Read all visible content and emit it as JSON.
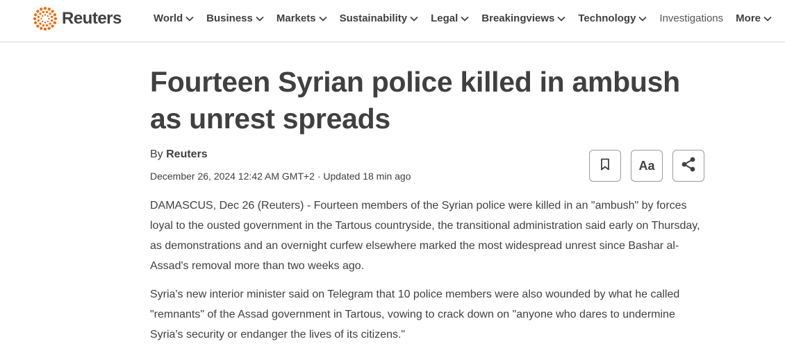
{
  "brand": {
    "name": "Reuters",
    "accent": "#fa6400"
  },
  "nav": {
    "items": [
      {
        "label": "World",
        "dropdown": true
      },
      {
        "label": "Business",
        "dropdown": true
      },
      {
        "label": "Markets",
        "dropdown": true
      },
      {
        "label": "Sustainability",
        "dropdown": true
      },
      {
        "label": "Legal",
        "dropdown": true
      },
      {
        "label": "Breakingviews",
        "dropdown": true
      },
      {
        "label": "Technology",
        "dropdown": true
      },
      {
        "label": "Investigations",
        "dropdown": false
      },
      {
        "label": "More",
        "dropdown": true
      }
    ]
  },
  "article": {
    "headline": "Fourteen Syrian police killed in ambush as unrest spreads",
    "byline_prefix": "By ",
    "byline_author": "Reuters",
    "dateline": "December 26, 2024 12:42 AM GMT+2 · Updated 18 min ago",
    "tools": {
      "bookmark_icon": "bookmark-icon",
      "text_size_label": "Aa",
      "share_icon": "share-icon"
    },
    "paragraphs": [
      "DAMASCUS, Dec 26 (Reuters) - Fourteen members of the Syrian police were killed in an \"ambush\" by forces loyal to the ousted government in the Tartous countryside, the transitional administration said early on Thursday, as demonstrations and an overnight curfew elsewhere marked the most widespread unrest since Bashar al-Assad's removal more than two weeks ago.",
      "Syria's new interior minister said on Telegram that 10 police members were also wounded by what he called \"remnants\" of the Assad government in Tartous, vowing to crack down on \"anyone who dares to undermine Syria's security or endanger the lives of its citizens.\""
    ]
  }
}
